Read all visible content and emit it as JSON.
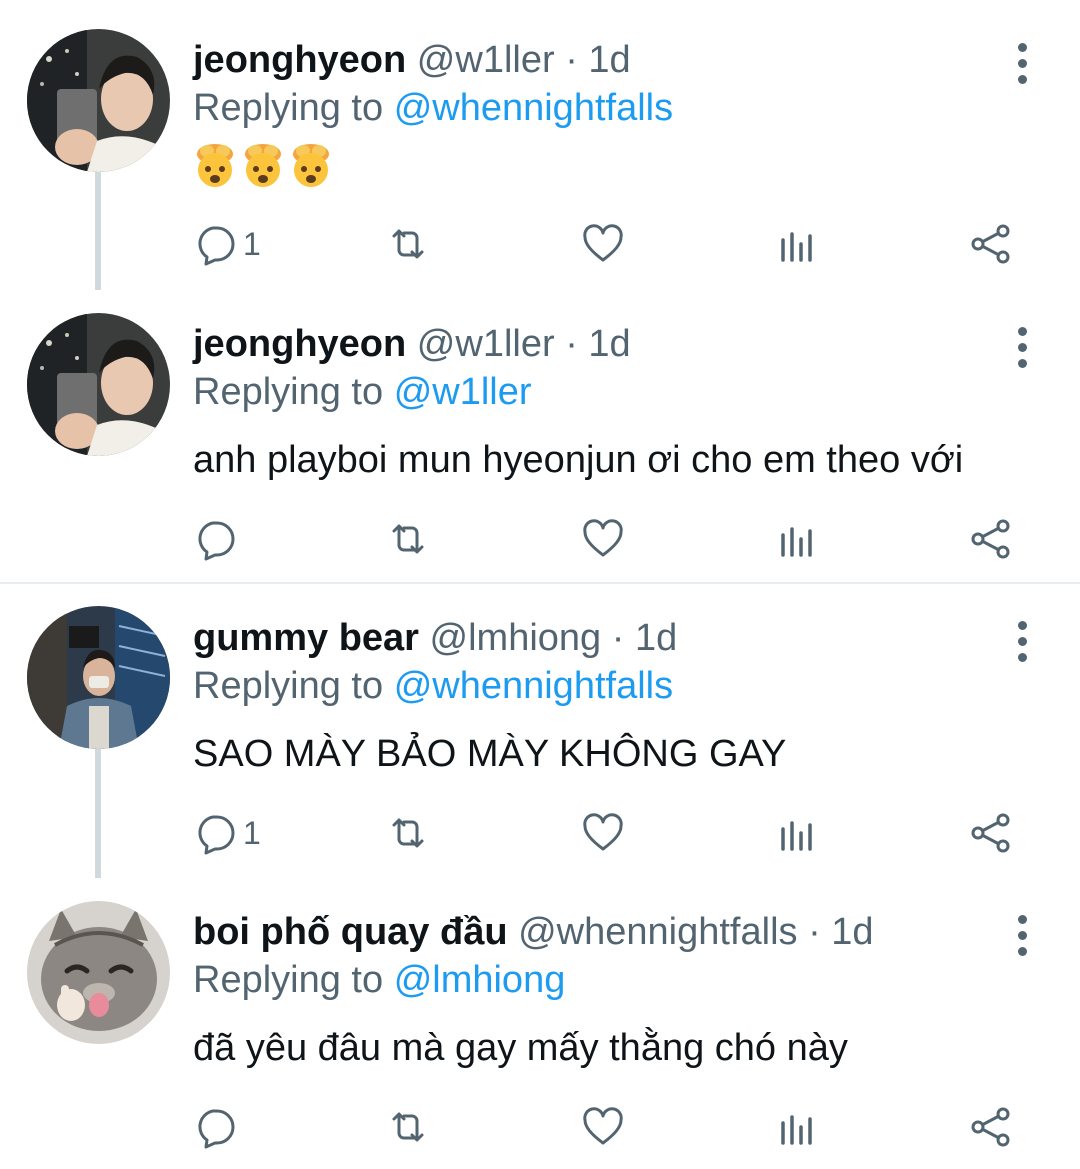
{
  "tweets": [
    {
      "name": "jeonghyeon",
      "handle": "@w1ller",
      "separator": "·",
      "time": "1d",
      "replying_prefix": "Replying to",
      "replying_to": "@whennightfalls",
      "text": "",
      "emoji": [
        "exploding-head",
        "exploding-head",
        "exploding-head"
      ],
      "reply_count": "1"
    },
    {
      "name": "jeonghyeon",
      "handle": "@w1ller",
      "separator": "·",
      "time": "1d",
      "replying_prefix": "Replying to",
      "replying_to": "@w1ller",
      "text": "anh playboi mun hyeonjun ơi cho em theo với",
      "reply_count": ""
    },
    {
      "name": "gummy bear",
      "handle": "@lmhiong",
      "separator": "·",
      "time": "1d",
      "replying_prefix": "Replying to",
      "replying_to": "@whennightfalls",
      "text": "SAO MÀY BẢO MÀY KHÔNG GAY",
      "reply_count": "1"
    },
    {
      "name": "boi phố quay đầu",
      "handle": "@whennightfalls",
      "separator": "·",
      "time": "1d",
      "replying_prefix": "Replying to",
      "replying_to": "@lmhiong",
      "text": "đã yêu đâu mà gay mấy thằng chó này",
      "reply_count": ""
    }
  ],
  "icons": {
    "reply": "reply-icon",
    "retweet": "retweet-icon",
    "like": "heart-icon",
    "views": "analytics-icon",
    "share": "share-icon",
    "more": "more-vertical-icon"
  },
  "colors": {
    "name": "#0f1419",
    "secondary": "#536471",
    "mention": "#1d9bf0",
    "thread_line": "#cfd9de",
    "divider": "#e6ecf0"
  }
}
